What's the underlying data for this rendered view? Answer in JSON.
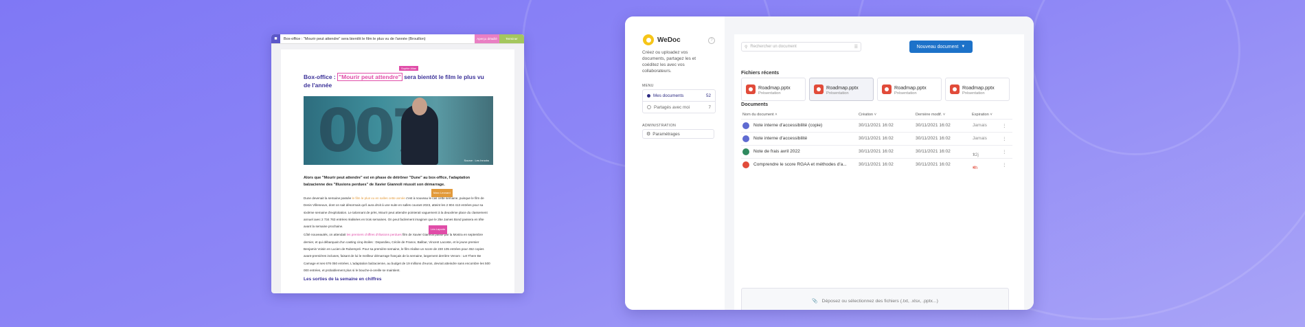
{
  "colors": {
    "accent": "#1d72c9",
    "brand": "#f6c518",
    "pink": "#e04ca8",
    "orange": "#e29a3b",
    "danger": "#e14b3a"
  },
  "editor": {
    "title": "Box-office : \"Mourir peut attendre\" sera bientôt le film le plus vu de l'année (Brouillon)",
    "btn_preview": "Aperçu détaillé",
    "btn_publish": "Terminer",
    "tag_author": "Sophie Allan",
    "headline_pre": "Box-office : ",
    "headline_hl": "\"Mourir peut attendre\"",
    "headline_post": " sera bientôt le film le plus vu de l'année",
    "image_source": "Source : Les Inrocks",
    "lead": "Alors que \"Mourir peut attendre\" est en phase de détrôner \"Dune\" au box-office, l'adaptation balzacienne des \"Illusions perdues\" de Xavier Giannoli réussit son démarrage.",
    "p1_a": "Dune devenait la semaine passée ",
    "p1_hl": "le film le plus vu en salles cette année",
    "p1_b": " c'est à nouveau le cas cette semaine, puisque le film de Denis Villeneuve, dont on sait désormais qu'il aura droit à une suite en salles courant 2023, atteint les 2 804 413 entrées pour sa sixième semaine d'exploitation. Le talonnant de près, Mourir peut attendre pointerait vaguement à la deuxième place du classement annuel avec 2 734 763 entrées réalisées en trois semaines. On peut facilement imaginer que le 25e James Bond passera en tête avant la semaine prochaine.",
    "p1_tag": "Marc Leonard",
    "p2_a": "Côté nouveautés, on attendait ",
    "p2_hl": "les premiers chiffres d'Illusions perdues",
    "p2_b": " film de Xavier Giannoli passé par la Mostra en septembre dernier, et qui débarquait d'un casting cinq étoiles : Depardieu, Cécile de France, Balibar, Vincent Lacoste, et le jeune premier Benjamin Voisin en Lucien de Rubempré. Pour sa première semaine, le film réalise un score de 230 105 entrées pour 452 copies avant-premières incluses, faisant de lui le meilleur démarrage français de la semaine, largement derrière Venom : Let There Be Carnage et ses 676 050 entrées. L'adaptation balzacienne, au budget de 19 millions d'euros, devrait atteindre sans encombre les 500 000 entrées, et probablement plus si le bouche-à-oreille se maintient.",
    "p2_tag": "Léa Laporte",
    "subhead": "Les sorties de la semaine en chiffres"
  },
  "app": {
    "brand": "WeDoc",
    "help_icon": "?",
    "description": "Créez ou uploadez vos documents, partagez les et coéditez les avec vos collaborateurs.",
    "menu_label": "MENU",
    "menu": [
      {
        "label": "Mes documents",
        "count": "52",
        "active": true
      },
      {
        "label": "Partagés avec moi",
        "count": "7",
        "active": false
      }
    ],
    "admin_label": "ADMINISTRATION",
    "settings_label": "Paramétrages",
    "search_placeholder": "Rechercher un document",
    "new_doc_label": "Nouveau document",
    "recent_title": "Fichiers récents",
    "recent_files": [
      {
        "name": "Roadmap.pptx",
        "type": "Présentation"
      },
      {
        "name": "Roadmap.pptx",
        "type": "Présentation"
      },
      {
        "name": "Roadmap.pptx",
        "type": "Présentation"
      },
      {
        "name": "Roadmap.pptx",
        "type": "Présentation"
      }
    ],
    "docs_title": "Documents",
    "columns": {
      "name": "Nom du document",
      "created": "Création",
      "modified": "Dernière modif.",
      "expiry": "Expiration"
    },
    "documents": [
      {
        "name": "Note interne d'accessibilité (copie)",
        "created": "30/11/2021 16:02",
        "modified": "30/11/2021 16:02",
        "expiry": "Jamais",
        "icon_color": "#5f6bd1"
      },
      {
        "name": "Note interne d'accessibilité",
        "created": "30/11/2021 16:02",
        "modified": "30/11/2021 16:02",
        "expiry": "Jamais",
        "icon_color": "#5f6bd1"
      },
      {
        "name": "Note de frais avril 2022",
        "created": "30/11/2021 16:02",
        "modified": "30/11/2021 16:02",
        "expiry": "12j",
        "icon_color": "#2f8a5f"
      },
      {
        "name": "Comprendre le score RGAA et méthodes d'a...",
        "created": "30/11/2021 16:02",
        "modified": "30/11/2021 16:02",
        "expiry": "4h",
        "icon_color": "#e14b3a"
      }
    ],
    "dropzone": "Déposez ou sélectionnez des fichiers (.txt, .xlsx, .pptx...)"
  }
}
